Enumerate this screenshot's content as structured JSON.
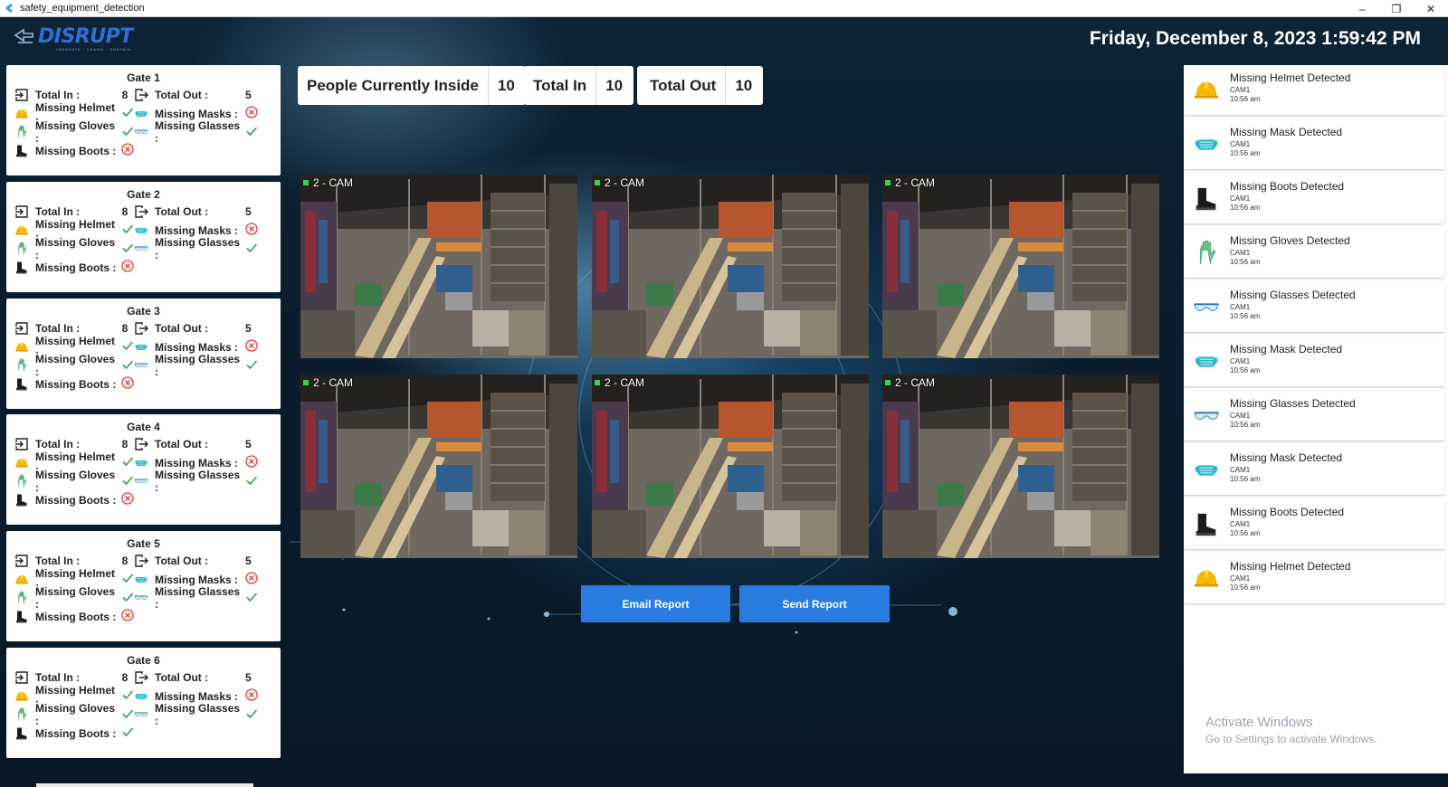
{
  "window": {
    "title": "safety_equipment_detection",
    "minimize": "–",
    "restore": "❐",
    "close": "✕"
  },
  "header": {
    "logo_text": "DISRUPT",
    "logo_sub": "INNOVATE · LEARN · SUSTAIN",
    "datetime": "Friday, December 8, 2023 1:59:42 PM"
  },
  "labels": {
    "total_in": "Total In :",
    "total_out": "Total Out :",
    "missing_helmet": "Missing Helmet :",
    "missing_masks": "Missing Masks :",
    "missing_gloves": "Missing Gloves :",
    "missing_glasses": "Missing Glasses :",
    "missing_boots": "Missing Boots :"
  },
  "gates": [
    {
      "title": "Gate 1",
      "total_in": "8",
      "total_out": "5",
      "helmet": "ok",
      "masks": "missing",
      "gloves": "ok",
      "glasses": "ok",
      "boots": "missing"
    },
    {
      "title": "Gate 2",
      "total_in": "8",
      "total_out": "5",
      "helmet": "ok",
      "masks": "missing",
      "gloves": "ok",
      "glasses": "ok",
      "boots": "missing"
    },
    {
      "title": "Gate 3",
      "total_in": "8",
      "total_out": "5",
      "helmet": "ok",
      "masks": "missing",
      "gloves": "ok",
      "glasses": "ok",
      "boots": "missing"
    },
    {
      "title": "Gate 4",
      "total_in": "8",
      "total_out": "5",
      "helmet": "ok",
      "masks": "missing",
      "gloves": "ok",
      "glasses": "ok",
      "boots": "missing"
    },
    {
      "title": "Gate 5",
      "total_in": "8",
      "total_out": "5",
      "helmet": "ok",
      "masks": "missing",
      "gloves": "ok",
      "glasses": "ok",
      "boots": "missing"
    },
    {
      "title": "Gate 6",
      "total_in": "8",
      "total_out": "5",
      "helmet": "ok",
      "masks": "missing",
      "gloves": "ok",
      "glasses": "ok",
      "boots": "ok"
    }
  ],
  "stats": {
    "inside_label": "People Currently Inside",
    "inside_value": "10",
    "in_label": "Total In",
    "in_value": "10",
    "out_label": "Total Out",
    "out_value": "10"
  },
  "cameras": [
    {
      "label": "2 - CAM"
    },
    {
      "label": "2 - CAM"
    },
    {
      "label": "2 - CAM"
    },
    {
      "label": "2 - CAM"
    },
    {
      "label": "2 - CAM"
    },
    {
      "label": "2 - CAM"
    }
  ],
  "actions": {
    "email": "Email Report",
    "send": "Send Report"
  },
  "alerts": [
    {
      "title": "Missing Helmet Detected",
      "cam": "CAM1",
      "time": "10:56 am",
      "icon": "helmet-icon"
    },
    {
      "title": "Missing Mask Detected",
      "cam": "CAM1",
      "time": "10:56 am",
      "icon": "mask-icon"
    },
    {
      "title": "Missing Boots Detected",
      "cam": "CAM1",
      "time": "10:56 am",
      "icon": "boot-icon"
    },
    {
      "title": "Missing Gloves Detected",
      "cam": "CAM1",
      "time": "10:56 am",
      "icon": "glove-icon"
    },
    {
      "title": "Missing Glasses Detected",
      "cam": "CAM1",
      "time": "10:56 am",
      "icon": "glasses-icon"
    },
    {
      "title": "Missing Mask Detected",
      "cam": "CAM1",
      "time": "10:56 am",
      "icon": "mask-icon"
    },
    {
      "title": "Missing Glasses Detected",
      "cam": "CAM1",
      "time": "10:56 am",
      "icon": "glasses-icon"
    },
    {
      "title": "Missing Mask Detected",
      "cam": "CAM1",
      "time": "10:56 am",
      "icon": "mask-icon"
    },
    {
      "title": "Missing Boots Detected",
      "cam": "CAM1",
      "time": "10:56 am",
      "icon": "boot-icon"
    },
    {
      "title": "Missing Helmet Detected",
      "cam": "CAM1",
      "time": "10:56 am",
      "icon": "helmet-icon"
    }
  ],
  "watermark": {
    "line1": "Activate Windows",
    "line2": "Go to Settings to activate Windows."
  },
  "colors": {
    "accent_button": "#2a7be0",
    "ok_check": "#2e9e4f",
    "missing_x": "#e53935",
    "helmet": "#f5b800",
    "mask": "#2bb7c9"
  }
}
